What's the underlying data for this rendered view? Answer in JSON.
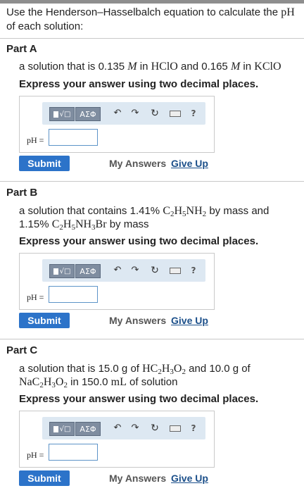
{
  "intro": {
    "text_before": "Use the Henderson–Hasselbalch equation to calculate the ",
    "math": "pH",
    "text_after": " of each solution:"
  },
  "toolbar": {
    "greek_label": "ΑΣΦ",
    "help_label": "?"
  },
  "answer": {
    "label": "pH =",
    "value": ""
  },
  "buttons": {
    "submit": "Submit",
    "my_answers": "My Answers",
    "give_up": "Give Up"
  },
  "parts": [
    {
      "title": "Part A",
      "q": {
        "t1": "a solution that is 0.135 ",
        "m1": "M",
        "t2": " in ",
        "c1": "HClO",
        "t3": " and 0.165 ",
        "m2": "M",
        "t4": " in ",
        "c2": "KClO"
      },
      "instruction": "Express your answer using two decimal places."
    },
    {
      "title": "Part B",
      "q": {
        "t1": "a solution that contains 1.41% ",
        "t2": " by mass and",
        "t3": "1.15% ",
        "t4": " by mass"
      },
      "instruction": "Express your answer using two decimal places."
    },
    {
      "title": "Part C",
      "q": {
        "t1": "a solution that is 15.0 g of ",
        "t2": " and 10.0 g of",
        "t3": " in 150.0 ",
        "t4": "mL",
        "t5": " of solution"
      },
      "instruction": "Express your answer using two decimal places."
    }
  ]
}
